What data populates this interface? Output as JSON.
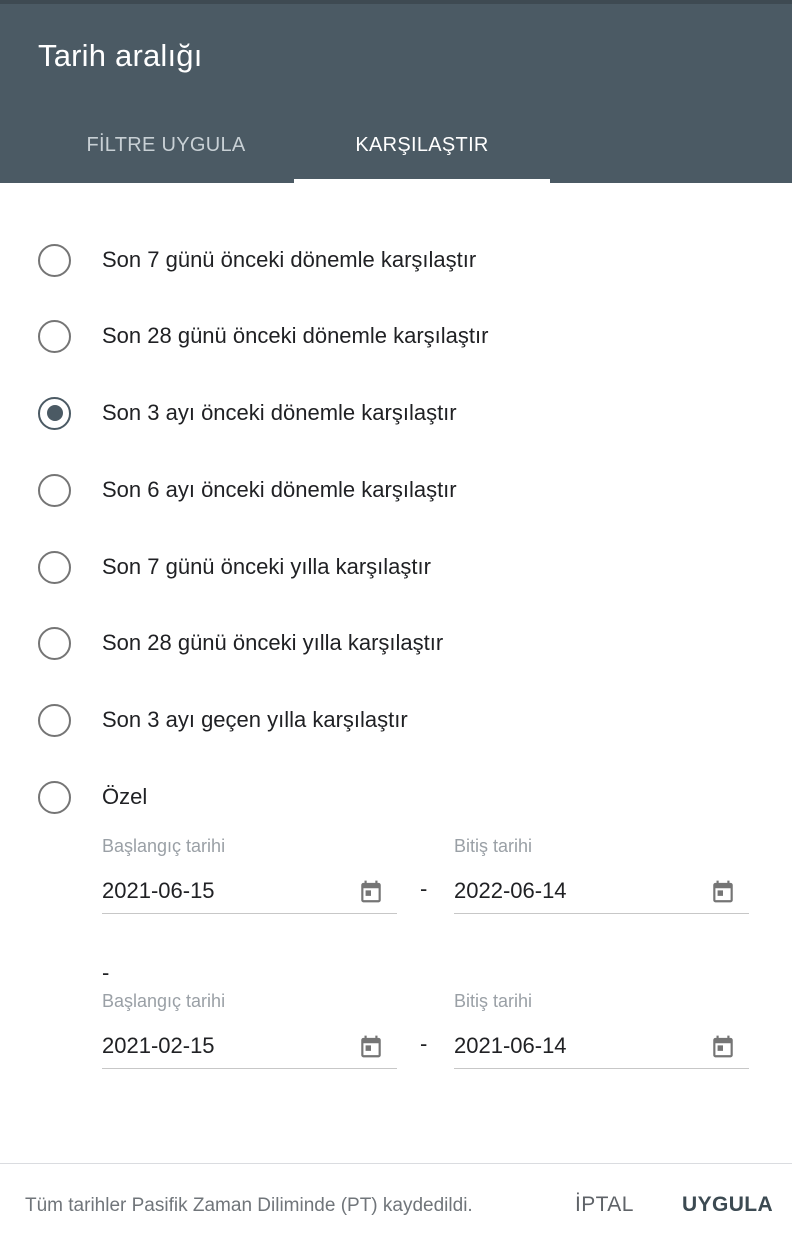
{
  "dialog": {
    "title": "Tarih aralığı",
    "tabs": [
      {
        "label": "FİLTRE UYGULA",
        "active": false
      },
      {
        "label": "KARŞILAŞTIR",
        "active": true
      }
    ]
  },
  "options": [
    {
      "label": "Son 7 günü önceki dönemle karşılaştır",
      "selected": false
    },
    {
      "label": "Son 28 günü önceki dönemle karşılaştır",
      "selected": false
    },
    {
      "label": "Son 3 ayı önceki dönemle karşılaştır",
      "selected": true
    },
    {
      "label": "Son 6 ayı önceki dönemle karşılaştır",
      "selected": false
    },
    {
      "label": "Son 7 günü önceki yılla karşılaştır",
      "selected": false
    },
    {
      "label": "Son 28 günü önceki yılla karşılaştır",
      "selected": false
    },
    {
      "label": "Son 3 ayı geçen yılla karşılaştır",
      "selected": false
    },
    {
      "label": "Özel",
      "selected": false
    }
  ],
  "custom": {
    "range1": {
      "start_label": "Başlangıç tarihi",
      "start_value": "2021-06-15",
      "end_label": "Bitiş tarihi",
      "end_value": "2022-06-14"
    },
    "separator": "-",
    "range2": {
      "start_label": "Başlangıç tarihi",
      "start_value": "2021-02-15",
      "end_label": "Bitiş tarihi",
      "end_value": "2021-06-14"
    }
  },
  "footer": {
    "note": "Tüm tarihler Pasifik Zaman Diliminde (PT) kaydedildi.",
    "cancel_label": "İPTAL",
    "apply_label": "UYGULA"
  },
  "colors": {
    "header_bg": "#4b5a64",
    "accent": "#4b5a64"
  }
}
